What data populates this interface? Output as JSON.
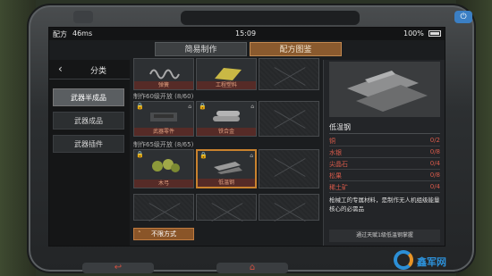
{
  "statusbar": {
    "carrier": "配方",
    "signal": "46ms",
    "time": "15:09",
    "battery": "100%"
  },
  "tabs": [
    {
      "label": "简易制作"
    },
    {
      "label": "配方图鉴"
    }
  ],
  "sidebar": {
    "title": "分类",
    "items": [
      {
        "label": "武器半成品"
      },
      {
        "label": "武器成品"
      },
      {
        "label": "武器插件"
      }
    ]
  },
  "sections": [
    {
      "label": ""
    },
    {
      "label": "制作60级开放 (8/60)"
    },
    {
      "label": "制作65级开放 (8/65)"
    }
  ],
  "cells": [
    {
      "label": "弹簧"
    },
    {
      "label": "工程塑料"
    },
    {
      "label": "武器零件"
    },
    {
      "label": "铁合金"
    },
    {
      "label": "木弓"
    },
    {
      "label": "低温钢"
    }
  ],
  "unlimited_button": {
    "label": "不限方式"
  },
  "detail": {
    "name": "低温钢",
    "materials": [
      {
        "name": "铜",
        "qty": "0/2"
      },
      {
        "name": "水银",
        "qty": "0/8"
      },
      {
        "name": "尖晶石",
        "qty": "0/4"
      },
      {
        "name": "松果",
        "qty": "0/8"
      },
      {
        "name": "稀土矿",
        "qty": "0/4"
      }
    ],
    "description": "枪械工的专属材料，是制作无人机组级能量核心的必需品",
    "footer": "通过天赋1级低温钢掌握"
  },
  "watermark": {
    "text": "鑫军网"
  },
  "device": {
    "back_label": "↩",
    "home_label": "⌂",
    "power_label": "⏻"
  }
}
